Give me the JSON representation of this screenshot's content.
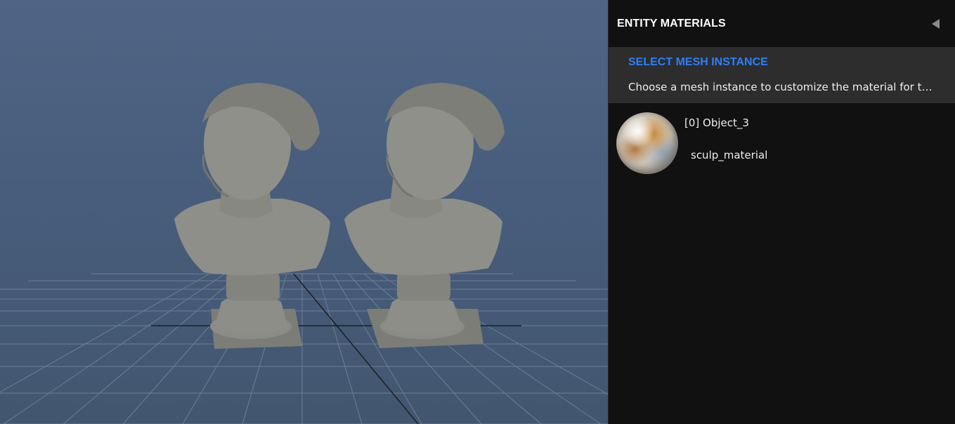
{
  "viewport": {
    "background_color": "#4a6080",
    "grid_color": "#6b7f96",
    "axis_color": "#1a1f26"
  },
  "panel": {
    "title": "ENTITY MATERIALS",
    "collapse_icon": "triangle-left-icon",
    "instruction": {
      "title": "SELECT MESH INSTANCE",
      "text": "Choose a mesh instance to customize the material for this entity.",
      "title_color": "#2a7fff"
    },
    "mesh_instances": [
      {
        "index_label": "[0] Object_3",
        "material": "sculp_material",
        "thumbnail_icon": "material-sphere-icon"
      }
    ]
  }
}
